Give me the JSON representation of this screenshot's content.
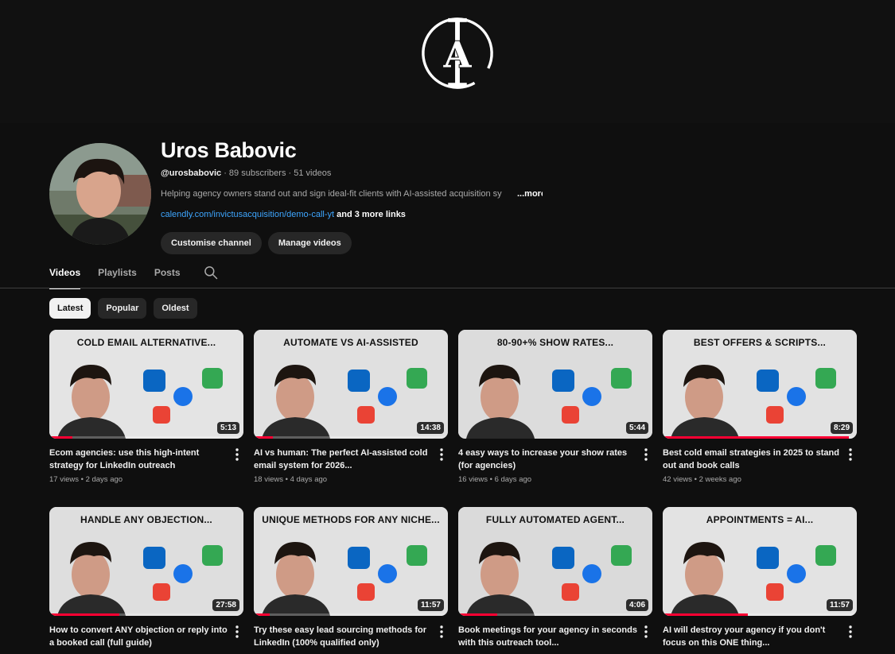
{
  "channel": {
    "name": "Uros Babovic",
    "handle": "@urosbabovic",
    "subscribers": "· 89 subscribers",
    "video_count": "· 51 videos",
    "description": "Helping agency owners stand out and sign ideal-fit clients with AI-assisted acquisition sy",
    "more_label": "...more",
    "link_url": "calendly.com/invictusacquisition/demo-call-yt",
    "more_links": " and 3 more links",
    "customise_label": "Customise channel",
    "manage_label": "Manage videos"
  },
  "banner": {
    "logo_icon": "invictus-a-logo"
  },
  "tabs": [
    {
      "label": "Videos",
      "active": true
    },
    {
      "label": "Playlists",
      "active": false
    },
    {
      "label": "Posts",
      "active": false
    }
  ],
  "chips": [
    {
      "label": "Latest",
      "active": true
    },
    {
      "label": "Popular",
      "active": false
    },
    {
      "label": "Oldest",
      "active": false
    }
  ],
  "videos": [
    {
      "caption": "COLD EMAIL ALTERNATIVE...",
      "duration": "5:13",
      "title": "Ecom agencies: use this high-intent strategy for LinkedIn outreach",
      "meta": "17 views • 2 days ago",
      "bg": "#e4e4e4",
      "watched": 0.12
    },
    {
      "caption": "AUTOMATE VS AI-ASSISTED",
      "duration": "14:38",
      "title": "AI vs human: The perfect AI-assisted cold email system for 2026...",
      "meta": "18 views • 4 days ago",
      "bg": "#e0e0e0",
      "watched": 0.1
    },
    {
      "caption": "80-90+% SHOW RATES...",
      "duration": "5:44",
      "title": "4 easy ways to increase your show rates (for agencies)",
      "meta": "16 views • 6 days ago",
      "bg": "#dcdcdc",
      "watched": 0
    },
    {
      "caption": "BEST OFFERS & SCRIPTS...",
      "duration": "8:29",
      "title": "Best cold email strategies in 2025 to stand out and book calls",
      "meta": "42 views • 2 weeks ago",
      "bg": "#e2e2e2",
      "watched": 0.96
    },
    {
      "caption": "HANDLE ANY OBJECTION...",
      "duration": "27:58",
      "title": "How to convert ANY objection or reply into a booked call (full guide)",
      "meta": "",
      "bg": "#dedede",
      "watched": 0.36
    },
    {
      "caption": "UNIQUE METHODS FOR ANY NICHE...",
      "duration": "11:57",
      "title": "Try these easy lead sourcing methods for LinkedIn (100% qualified only)",
      "meta": "",
      "bg": "#e1e1e1",
      "watched": 0.08
    },
    {
      "caption": "FULLY AUTOMATED AGENT...",
      "duration": "4:06",
      "title": "Book meetings for your agency in seconds with this outreach tool...",
      "meta": "",
      "bg": "#dadada",
      "watched": 0.2
    },
    {
      "caption": "APPOINTMENTS = AI...",
      "duration": "11:57",
      "title": "AI will destroy your agency if you don't focus on this ONE thing...",
      "meta": "",
      "bg": "#e3e3e3",
      "watched": 0.44
    }
  ]
}
